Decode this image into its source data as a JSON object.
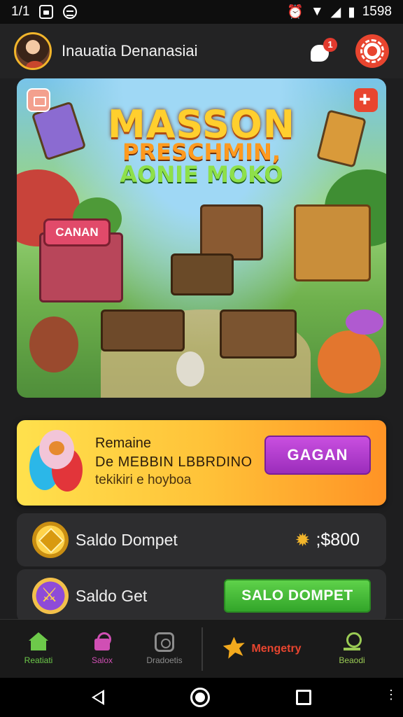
{
  "status_bar": {
    "time_left": "1/1",
    "time_right": "1598",
    "icons": [
      "image-icon",
      "sync-icon",
      "alarm-icon",
      "wifi-icon",
      "signal-icon",
      "battery-icon"
    ]
  },
  "header": {
    "username": "Inauatia Denanasiai",
    "notification_count": "1"
  },
  "banner": {
    "title_line1": "MASSON",
    "title_line2": "PRESCHMIN,",
    "title_line3": "AONIE MOKO",
    "sign_text": "CANAN"
  },
  "offer": {
    "line1": "Remaine",
    "line2": "De MEBBIN LBBRDINO",
    "line3": "tekikiri e hoyboa",
    "button_label": "GAGAN"
  },
  "wallet_card": {
    "label": "Saldo Dompet",
    "amount": ";$800"
  },
  "get_card": {
    "label": "Saldo Get",
    "button_label": "SALO DOMPET"
  },
  "bottom_nav": {
    "items": [
      {
        "label": "Reatiati",
        "color": "#6dc94a"
      },
      {
        "label": "Salox",
        "color": "#d04fb4"
      },
      {
        "label": "Dradoetis",
        "color": "#8c8c8c"
      },
      {
        "label": "Mengetry",
        "color": "#e8452f"
      },
      {
        "label": "Beaodi",
        "color": "#9acb54"
      }
    ]
  },
  "colors": {
    "accent_red": "#e8452f",
    "gold": "#f2b52b",
    "offer_purple": "#b63fd2",
    "green": "#4cbf3a"
  }
}
